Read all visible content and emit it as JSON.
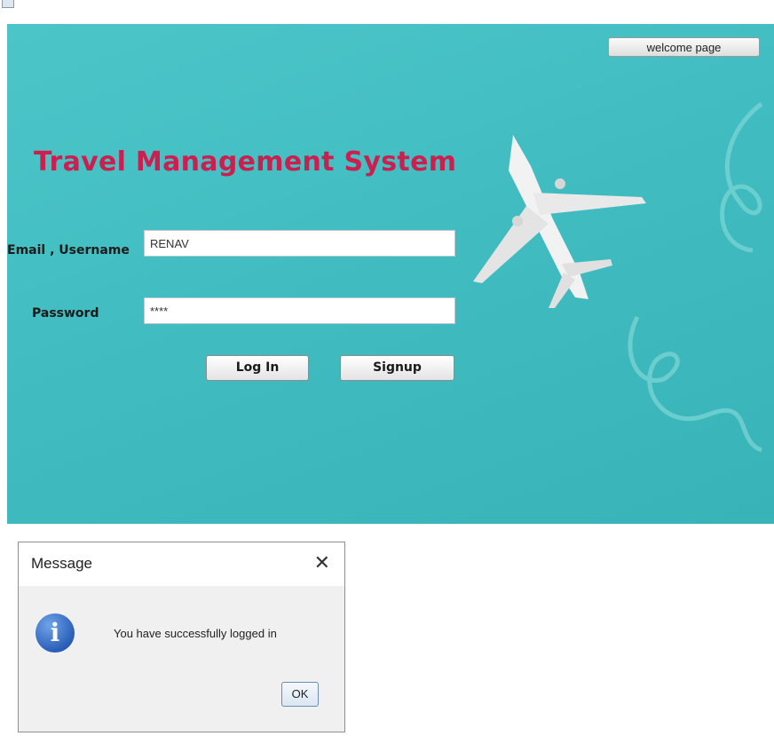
{
  "window": {
    "icon": "window-menu-icon"
  },
  "header": {
    "welcome_label": "welcome page"
  },
  "main": {
    "title": "Travel Management System",
    "form": {
      "email_label": "Email , Username",
      "email_value": "RENAV",
      "password_label": "Password",
      "password_value": "****",
      "login_label": "Log In",
      "signup_label": "Signup"
    },
    "background": {
      "image": "airplane-illustration",
      "accent": "#42bfc3"
    }
  },
  "dialog": {
    "title": "Message",
    "close_icon": "close-icon",
    "icon": "info-icon",
    "icon_glyph": "i",
    "message": "You have successfully logged in",
    "ok_label": "OK"
  },
  "colors": {
    "title": "#cc1f4f",
    "panel": "#42bfc3",
    "info_icon": "#2a5fb8"
  }
}
